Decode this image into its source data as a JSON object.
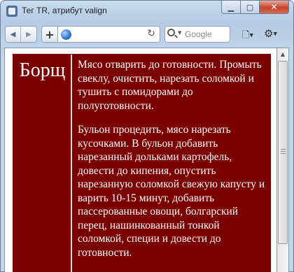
{
  "window": {
    "title": "Тег TR, атрибут valign",
    "buttons": {
      "minimize": "▁",
      "maximize": "▢",
      "close": "✕"
    }
  },
  "toolbar": {
    "back_symbol": "◀",
    "forward_symbol": "▶",
    "add_symbol": "+",
    "reload_symbol": "↻",
    "search_placeholder": "Google",
    "page_symbol": "🗋",
    "gear_symbol": "⚙"
  },
  "content": {
    "title": "Борщ",
    "paragraphs": [
      "Мясо отварить до готовности. Промыть свеклу, очистить, нарезать соломкой и тушить с помидорами до полуготовности.",
      "Бульон процедить, мясо нарезать кусочками. В бульон добавить нарезанный дольками картофель, довести до кипения, опустить нарезанную соломкой свежую капусту и варить 10-15 минут, добавить пассерованные овощи, болгарский перец, нашинкованный тонкой соломкой, специи и довести до готовности."
    ]
  },
  "colors": {
    "cell_background": "#7b0000",
    "cell_text": "#ffffff"
  }
}
